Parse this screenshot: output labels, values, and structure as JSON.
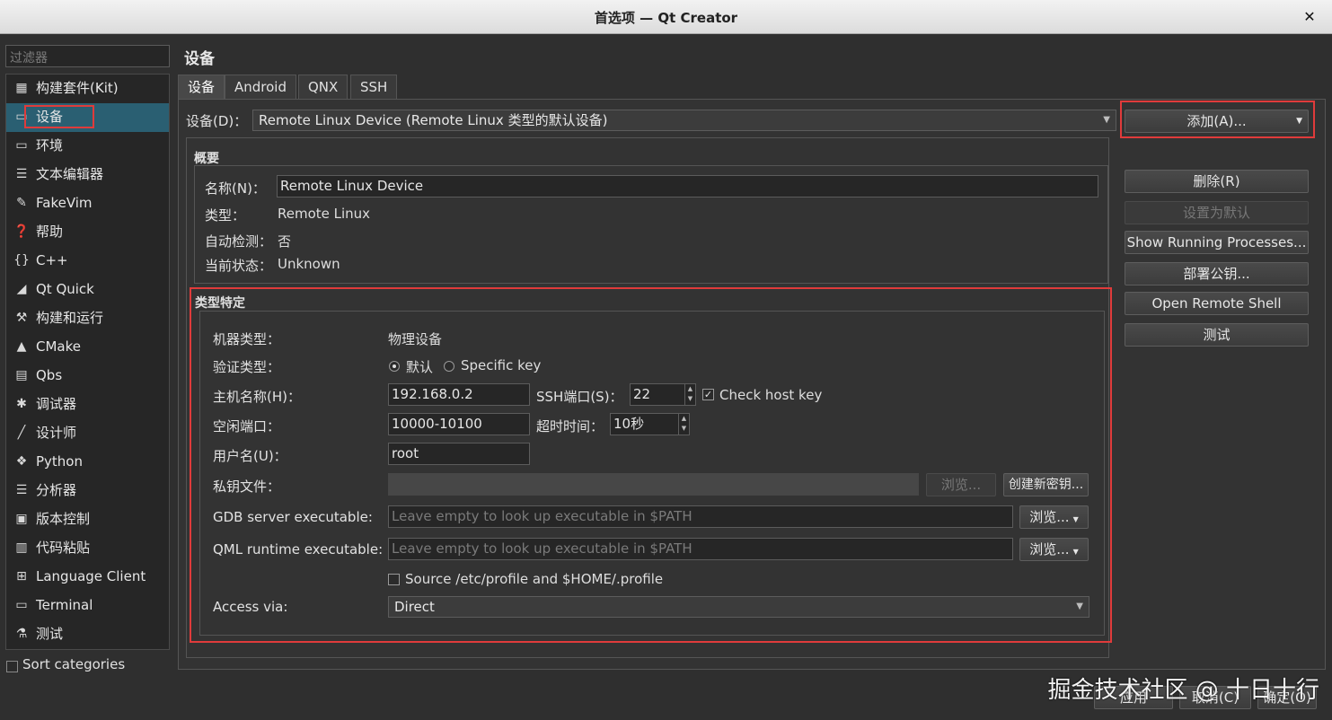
{
  "window": {
    "title": "首选项 — Qt Creator"
  },
  "filter": {
    "placeholder": "过滤器"
  },
  "categories": [
    {
      "label": "构建套件(Kit)",
      "icon": "kit-icon"
    },
    {
      "label": "设备",
      "icon": "device-icon"
    },
    {
      "label": "环境",
      "icon": "monitor-icon"
    },
    {
      "label": "文本编辑器",
      "icon": "text-editor-icon"
    },
    {
      "label": "FakeVim",
      "icon": "fakevim-icon"
    },
    {
      "label": "帮助",
      "icon": "help-icon"
    },
    {
      "label": "C++",
      "icon": "braces-icon"
    },
    {
      "label": "Qt Quick",
      "icon": "qtquick-icon"
    },
    {
      "label": "构建和运行",
      "icon": "hammer-icon"
    },
    {
      "label": "CMake",
      "icon": "cmake-icon"
    },
    {
      "label": "Qbs",
      "icon": "qbs-icon"
    },
    {
      "label": "调试器",
      "icon": "bug-icon"
    },
    {
      "label": "设计师",
      "icon": "pen-icon"
    },
    {
      "label": "Python",
      "icon": "python-icon"
    },
    {
      "label": "分析器",
      "icon": "analyzer-icon"
    },
    {
      "label": "版本控制",
      "icon": "version-control-icon"
    },
    {
      "label": "代码粘贴",
      "icon": "paste-icon"
    },
    {
      "label": "Language Client",
      "icon": "language-client-icon"
    },
    {
      "label": "Terminal",
      "icon": "terminal-icon"
    },
    {
      "label": "测试",
      "icon": "test-icon"
    }
  ],
  "sort_categories": "Sort categories",
  "page_title": "设备",
  "tabs": [
    "设备",
    "Android",
    "QNX",
    "SSH"
  ],
  "device_row": {
    "label": "设备(D)：",
    "value": "Remote Linux Device (Remote Linux 类型的默认设备)"
  },
  "right_buttons": {
    "add": "添加(A)...",
    "remove": "删除(R)",
    "set_default": "设置为默认",
    "show_processes": "Show Running Processes...",
    "deploy_key": "部署公钥...",
    "open_shell": "Open Remote Shell",
    "test": "测试"
  },
  "general": {
    "title": "概要",
    "name_label": "名称(N)：",
    "name_value": "Remote Linux Device",
    "type_label": "类型：",
    "type_value": "Remote Linux",
    "autodetect_label": "自动检测：",
    "autodetect_value": "否",
    "state_label": "当前状态：",
    "state_value": "Unknown"
  },
  "specific": {
    "title": "类型特定",
    "machine_type_label": "机器类型：",
    "machine_type_value": "物理设备",
    "auth_label": "验证类型：",
    "auth_default": "默认",
    "auth_specific": "Specific key",
    "host_label": "主机名称(H)：",
    "host_value": "192.168.0.2",
    "ssh_port_label": "SSH端口(S)：",
    "ssh_port_value": "22",
    "check_host_key": "Check host key",
    "free_ports_label": "空闲端口：",
    "free_ports_value": "10000-10100",
    "timeout_label": "超时时间：",
    "timeout_value": "10秒",
    "user_label": "用户名(U)：",
    "user_value": "root",
    "key_label": "私钥文件：",
    "browse_disabled": "浏览...",
    "create_key": "创建新密钥...",
    "gdb_label": "GDB server executable:",
    "gdb_placeholder": "Leave empty to look up executable in $PATH",
    "gdb_browse": "浏览...",
    "qml_label": "QML runtime executable:",
    "qml_placeholder": "Leave empty to look up executable in $PATH",
    "qml_browse": "浏览...",
    "source_profile": "Source /etc/profile and $HOME/.profile",
    "access_label": "Access via:",
    "access_value": "Direct"
  },
  "bottom_buttons": {
    "apply": "应用",
    "cancel": "取消(C)",
    "ok": "确定(O)"
  },
  "watermark": "掘金技术社区 @ 十日十行",
  "colors": {
    "highlight": "#e03b3b",
    "selection": "#2a5f72"
  }
}
